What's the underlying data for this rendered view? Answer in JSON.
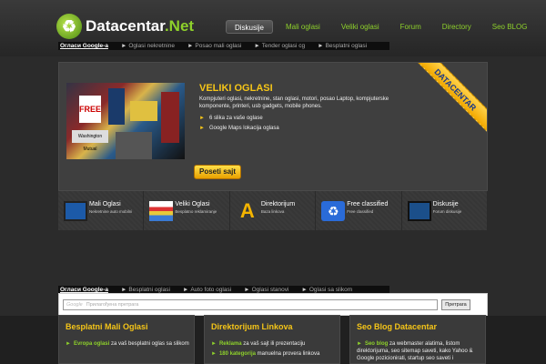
{
  "site": {
    "logo_name": "Datacentar",
    "logo_tld": ".Net"
  },
  "nav": [
    {
      "label": "Diskusije",
      "active": true
    },
    {
      "label": "Mali oglasi",
      "active": false
    },
    {
      "label": "Veliki oglasi",
      "active": false
    },
    {
      "label": "Forum",
      "active": false
    },
    {
      "label": "Directory",
      "active": false
    },
    {
      "label": "Seo BLOG",
      "active": false
    }
  ],
  "top_links": [
    "Огласи Google-а",
    "Oglasi nekretnine",
    "Posao mali oglasi",
    "Tender oglasi cg",
    "Besplatni oglasi"
  ],
  "hero": {
    "title": "VELIKI OGLASI",
    "description": "Kompjuteri oglasi, nekretnine, stan oglasi, motori, posao Laptop, kompjuterske komponente, printeri, usb gadgets, mobile phones.",
    "bullets": [
      "6 slika za vaše oglase",
      "Google Maps lokacija oglasa"
    ],
    "button": "Poseti sajt",
    "ribbon": "DATACENTAR"
  },
  "categories": [
    {
      "label": "Mali Oglasi",
      "sub": "Nekretnine auto mobilni",
      "icon": "monitor-icon"
    },
    {
      "label": "Veliki Oglasi",
      "sub": "Besplatno reklamiranje",
      "icon": "printer-icon"
    },
    {
      "label": "Direktorijum",
      "sub": "Baza linkova",
      "icon": "letter-a-icon"
    },
    {
      "label": "Free classified",
      "sub": "Free classified",
      "icon": "recycle-icon"
    },
    {
      "label": "Diskusije",
      "sub": "Forum diskusije",
      "icon": "tablet-icon"
    }
  ],
  "bottom_links": [
    "Огласи Google-а",
    "Besplatni oglasi",
    "Auto foto oglasi",
    "Oglasi stanovi",
    "Oglasi sa slikom"
  ],
  "google": {
    "placeholder": "Прилагођена претрага",
    "logo": "Google",
    "button": "Претрага"
  },
  "columns": [
    {
      "title": "Besplatni Mali Oglasi",
      "line1_bold": "Evropa oglasi",
      "line1": " za vaš besplatni oglas sa slikom"
    },
    {
      "title": "Direktorijum Linkova",
      "line1_bold": "Reklama",
      "line1": " za vaš sajt ili prezentaciju",
      "line2_bold": "180 kategorija",
      "line2": " manuelna provera linkova"
    },
    {
      "title": "Seo Blog Datacentar",
      "line1_bold": "Seo blog",
      "line1": " za webmaster alatima, listom direktorijuma, seo sitemap saveti, kako Yahoo & Google pozicionirati, startup seo saveti i"
    }
  ]
}
